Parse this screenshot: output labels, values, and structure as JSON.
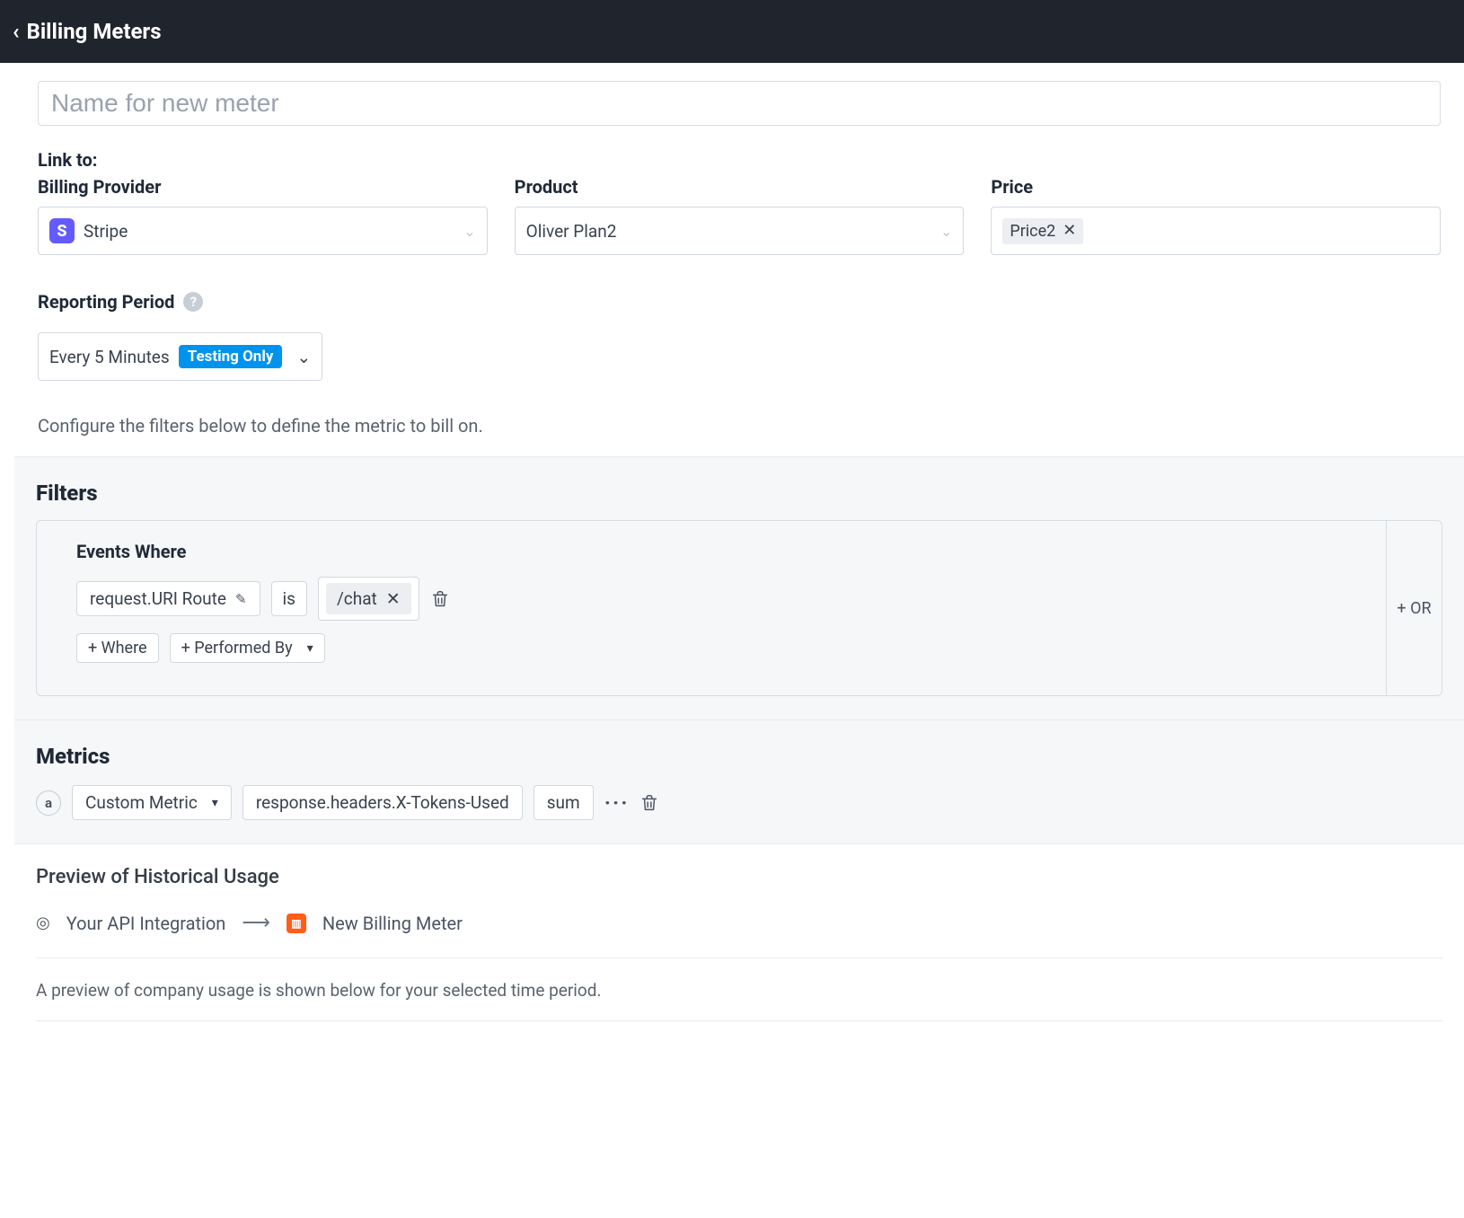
{
  "header": {
    "title": "Billing Meters"
  },
  "nameInput": {
    "placeholder": "Name for new meter"
  },
  "linkTo": {
    "label": "Link to:",
    "provider": {
      "label": "Billing Provider",
      "value": "Stripe"
    },
    "product": {
      "label": "Product",
      "value": "Oliver Plan2"
    },
    "price": {
      "label": "Price",
      "chip": "Price2"
    }
  },
  "reporting": {
    "label": "Reporting Period",
    "value": "Every 5 Minutes",
    "badge": "Testing Only"
  },
  "filterHint": "Configure the filters below to define the metric to bill on.",
  "filters": {
    "heading": "Filters",
    "eventsWhere": "Events Where",
    "field": "request.URI Route",
    "operator": "is",
    "value": "/chat",
    "addWhere": "+ Where",
    "addPerformedBy": "+ Performed By",
    "or": "+ OR"
  },
  "metrics": {
    "heading": "Metrics",
    "letter": "a",
    "type": "Custom Metric",
    "path": "response.headers.X-Tokens-Used",
    "agg": "sum"
  },
  "preview": {
    "heading": "Preview of Historical Usage",
    "source": "Your API Integration",
    "target": "New Billing Meter",
    "desc": "A preview of company usage is shown below for your selected time period."
  }
}
